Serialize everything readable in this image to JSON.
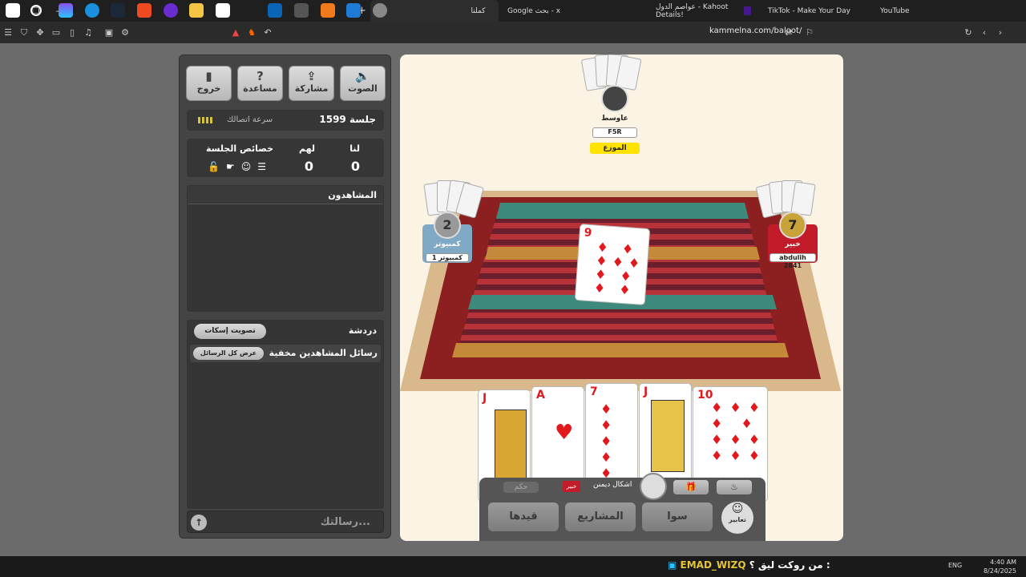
{
  "browser": {
    "tabs": [
      {
        "label": "YouTube"
      },
      {
        "label": "TikTok - Make Your Day"
      },
      {
        "label": "عواصم الدول - Kahoot Details!"
      },
      {
        "label": "Google بحث - x"
      },
      {
        "label": "كملنا"
      }
    ],
    "url": "kammelna.com/baloot/"
  },
  "panel": {
    "buttons": [
      {
        "label": "الصوت",
        "icon": "🔈×"
      },
      {
        "label": "مشاركة",
        "icon": "⇪"
      },
      {
        "label": "مساعدة",
        "icon": "?"
      },
      {
        "label": "خروج",
        "icon": "▮"
      }
    ],
    "session_id": "جلسة 1599",
    "connection_speed": "سرعة اتصالك",
    "score": {
      "us_label": "لنا",
      "us_value": "0",
      "them_label": "لهم",
      "them_value": "0",
      "props_label": "خصائص الجلسة"
    },
    "watchers_title": "المشاهدون",
    "chat_title": "دردشة",
    "mute_vote": "تصويت إسكات",
    "hidden_msgs": "رسائل المشاهدين مخفية",
    "show_all": "عرض كل الرسائل",
    "message_placeholder": "رسالتك..."
  },
  "game": {
    "top_player": {
      "name": "عاوسط",
      "tag": "F5R",
      "dealer": "الموزع"
    },
    "left_player": {
      "name": "كمبيوتر",
      "tag": "كمبيوتر 1",
      "level": "2"
    },
    "right_player": {
      "name": "خبير",
      "tag": "abdulih 2841",
      "level": "7"
    },
    "table_card": {
      "rank": "9",
      "suit": "♦"
    },
    "hand": [
      {
        "rank": "J",
        "suit": "♥"
      },
      {
        "rank": "A",
        "suit": "♥"
      },
      {
        "rank": "7",
        "suit": "♦"
      },
      {
        "rank": "J",
        "suit": "♦"
      },
      {
        "rank": "10",
        "suit": "♦"
      }
    ],
    "hud": {
      "hokum": "حكم",
      "expert": "خبير",
      "diamonds_shapes": "اشكال ديمنن",
      "btn_qaydha": "قيدها",
      "btn_projects": "المشاريع",
      "btn_sawa": "سوا",
      "btn_expressions": "تعابير"
    }
  },
  "taskbar": {
    "ticker_text": "من روكت ليق ؟ :",
    "ticker_name": "EMAD_WIZQ",
    "lang": "ENG",
    "time": "4:40 AM",
    "date": "8/24/2025"
  }
}
